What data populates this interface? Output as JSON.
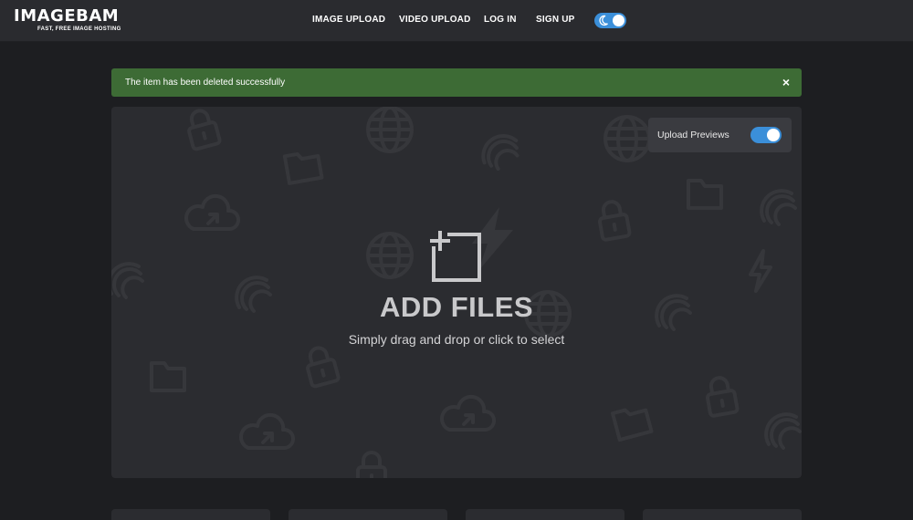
{
  "header": {
    "logo_title": "IMAGEBAM",
    "logo_tagline": "FAST, FREE IMAGE HOSTING",
    "nav": {
      "image_upload": "IMAGE UPLOAD",
      "video_upload": "VIDEO UPLOAD",
      "log_in": "LOG IN",
      "sign_up": "SIGN UP"
    },
    "theme_toggle": {
      "icon": "moon-icon",
      "state": "on"
    }
  },
  "alert": {
    "message": "The item has been deleted successfully",
    "close_label": "×"
  },
  "upload": {
    "previews_label": "Upload Previews",
    "previews_enabled": true,
    "title": "ADD FILES",
    "subtitle": "Simply drag and drop or click to select",
    "add_icon": "add-image-icon"
  },
  "colors": {
    "page_bg": "#1d1e21",
    "header_bg": "#2a2b2f",
    "alert_bg": "#3d6b35",
    "accent": "#3b8fd9"
  }
}
